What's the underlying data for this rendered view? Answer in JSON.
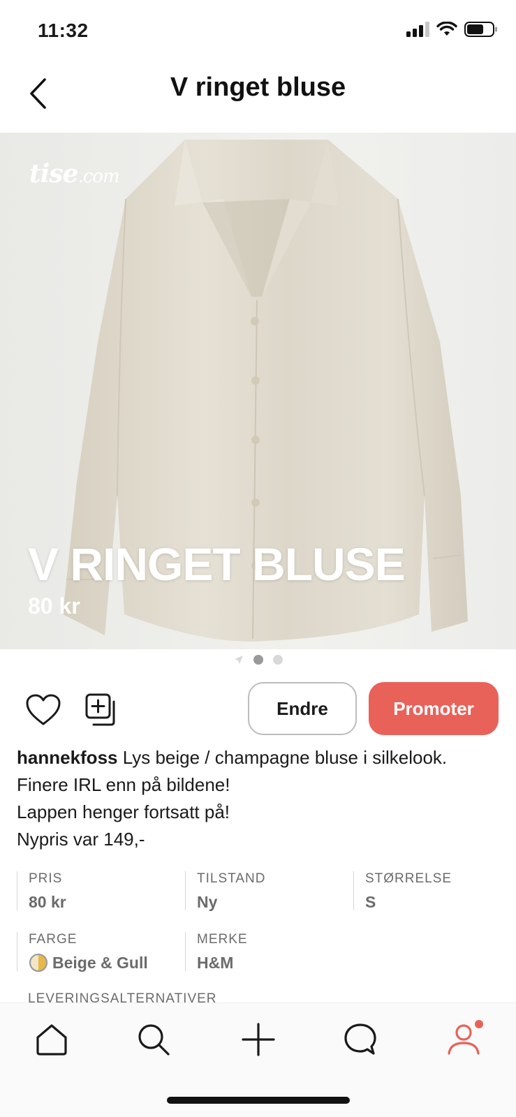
{
  "status_bar": {
    "time": "11:32"
  },
  "header": {
    "title": "V ringet bluse"
  },
  "product": {
    "watermark": "tise",
    "watermark_suffix": ".com",
    "overlay_title": "V RINGET BLUSE",
    "overlay_price": "80 kr",
    "image_count": 2,
    "active_image": 0
  },
  "actions": {
    "edit_label": "Endre",
    "promote_label": "Promoter"
  },
  "description": {
    "username": "hannekfoss",
    "first_line": " Lys beige / champagne bluse i silkelook.",
    "lines": [
      "Finere IRL enn på bildene!",
      "Lappen henger fortsatt på!",
      "Nypris var 149,-"
    ]
  },
  "attributes": [
    {
      "label": "PRIS",
      "value": "80 kr"
    },
    {
      "label": "TILSTAND",
      "value": "Ny"
    },
    {
      "label": "STØRRELSE",
      "value": "S"
    },
    {
      "label": "FARGE",
      "value": "Beige & Gull"
    },
    {
      "label": "MERKE",
      "value": "H&M"
    }
  ],
  "partial_label": "LEVERINGSALTERNATIVER",
  "colors": {
    "accent": "#e8625a",
    "swatch_beige": "#f3e6c4",
    "swatch_gold": "#e7b84a"
  },
  "bottom_nav": [
    {
      "name": "home",
      "icon": "home-icon"
    },
    {
      "name": "search",
      "icon": "search-icon"
    },
    {
      "name": "add",
      "icon": "plus-icon"
    },
    {
      "name": "messages",
      "icon": "chat-bubble-icon"
    },
    {
      "name": "profile",
      "icon": "profile-icon",
      "has_notification": true
    }
  ]
}
